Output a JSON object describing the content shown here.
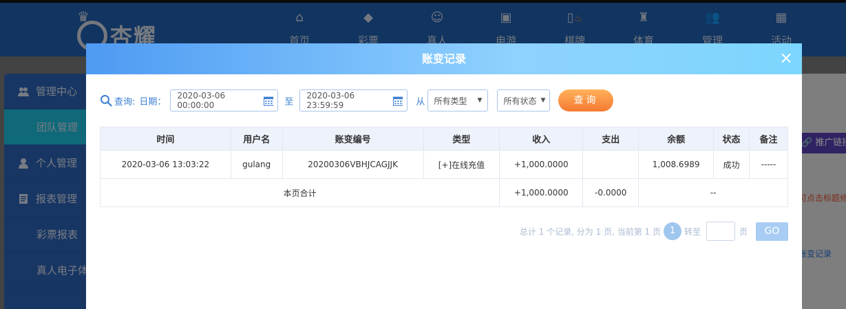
{
  "app": {
    "logo_text": "杏耀",
    "nav": [
      {
        "label": "首页",
        "icon": "home-icon"
      },
      {
        "label": "彩票",
        "icon": "lottery-icon"
      },
      {
        "label": "真人",
        "icon": "live-dealer-icon"
      },
      {
        "label": "电游",
        "icon": "slot-machine-icon"
      },
      {
        "label": "棋牌",
        "icon": "cards-icon"
      },
      {
        "label": "体育",
        "icon": "trophy-icon"
      },
      {
        "label": "管理",
        "icon": "users-icon"
      },
      {
        "label": "活动",
        "icon": "gift-icon"
      }
    ],
    "sidebar": [
      {
        "label": "管理中心",
        "icon": "users-icon"
      },
      {
        "label": "团队管理"
      },
      {
        "label": "个人管理",
        "icon": "user-icon"
      },
      {
        "label": "报表管理",
        "icon": "report-icon"
      },
      {
        "label": "彩票报表"
      },
      {
        "label": "真人电子体"
      }
    ],
    "right_panel": {
      "promo_button": "推广链接",
      "hint": "可点击标题修",
      "link": "账变记录"
    }
  },
  "modal": {
    "title": "账变记录",
    "close_glyph": "×",
    "filters": {
      "query_label": "查询:",
      "date_label": "日期：",
      "start_date": "2020-03-06 00:00:00",
      "to_label": "至",
      "end_date": "2020-03-06 23:59:59",
      "from_label": "从",
      "type_select": "所有类型",
      "status_select": "所有状态",
      "search_button": "查询"
    },
    "table": {
      "headers": [
        "时间",
        "用户名",
        "账变编号",
        "类型",
        "收入",
        "支出",
        "余额",
        "状态",
        "备注"
      ],
      "row": {
        "time": "2020-03-06 13:03:22",
        "username": "gulang",
        "record_id": "20200306VBHJCAGJJK",
        "type": "[+]在线充值",
        "income": "+1,000.0000",
        "expense": "",
        "balance": "1,008.6989",
        "status": "成功",
        "remark": "-----"
      },
      "total": {
        "label": "本页合计",
        "income": "+1,000.0000",
        "expense": "-0.0000",
        "rest": "--"
      }
    },
    "pagination": {
      "summary": "总计 1 个记录, 分为 1 页, 当前第 1 页",
      "current_page": "1",
      "goto_label": "转至",
      "page_suffix": "页",
      "go_button": "GO"
    }
  },
  "colors": {
    "accent": "#3b7fd3",
    "search_button": "#f57a33",
    "income": "#4a9a2b"
  }
}
